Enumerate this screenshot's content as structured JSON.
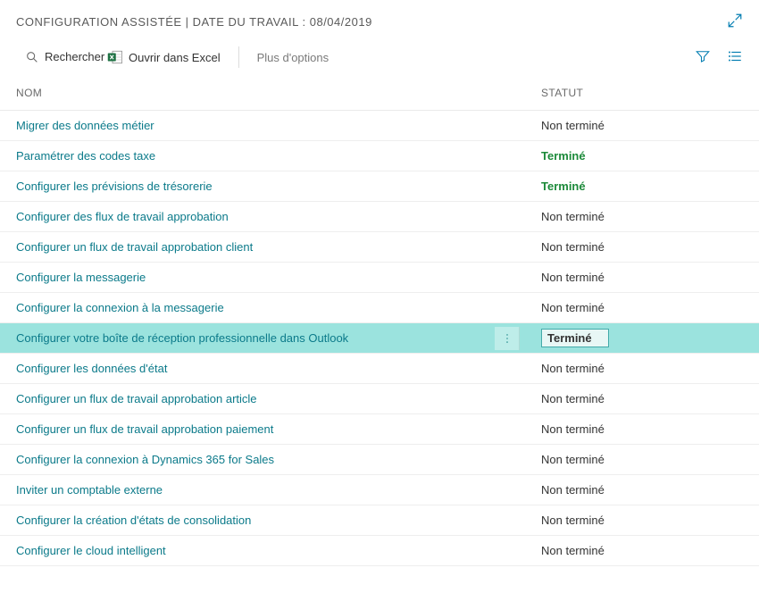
{
  "header": {
    "title": "CONFIGURATION ASSISTÉE | DATE DU TRAVAIL : 08/04/2019"
  },
  "toolbar": {
    "search_label": "Rechercher",
    "excel_label": "Ouvrir dans Excel",
    "more_options": "Plus d'options"
  },
  "columns": {
    "nom": "Nom",
    "statut": "Statut"
  },
  "status_labels": {
    "not_done": "Non terminé",
    "done": "Terminé"
  },
  "rows": [
    {
      "name": "Migrer des données métier",
      "status": "not_done",
      "selected": false
    },
    {
      "name": "Paramétrer des codes taxe",
      "status": "done",
      "selected": false
    },
    {
      "name": "Configurer les prévisions de trésorerie",
      "status": "done",
      "selected": false
    },
    {
      "name": "Configurer des flux de travail approbation",
      "status": "not_done",
      "selected": false
    },
    {
      "name": "Configurer un flux de travail approbation client",
      "status": "not_done",
      "selected": false
    },
    {
      "name": "Configurer la messagerie",
      "status": "not_done",
      "selected": false
    },
    {
      "name": "Configurer la connexion à la messagerie",
      "status": "not_done",
      "selected": false
    },
    {
      "name": "Configurer votre boîte de réception professionnelle dans Outlook",
      "status": "done",
      "selected": true
    },
    {
      "name": "Configurer les données d'état",
      "status": "not_done",
      "selected": false
    },
    {
      "name": "Configurer un flux de travail approbation article",
      "status": "not_done",
      "selected": false
    },
    {
      "name": "Configurer un flux de travail approbation paiement",
      "status": "not_done",
      "selected": false
    },
    {
      "name": "Configurer la connexion à Dynamics 365 for Sales",
      "status": "not_done",
      "selected": false
    },
    {
      "name": "Inviter un comptable externe",
      "status": "not_done",
      "selected": false
    },
    {
      "name": "Configurer la création d'états de consolidation",
      "status": "not_done",
      "selected": false
    },
    {
      "name": "Configurer le cloud intelligent",
      "status": "not_done",
      "selected": false
    }
  ]
}
